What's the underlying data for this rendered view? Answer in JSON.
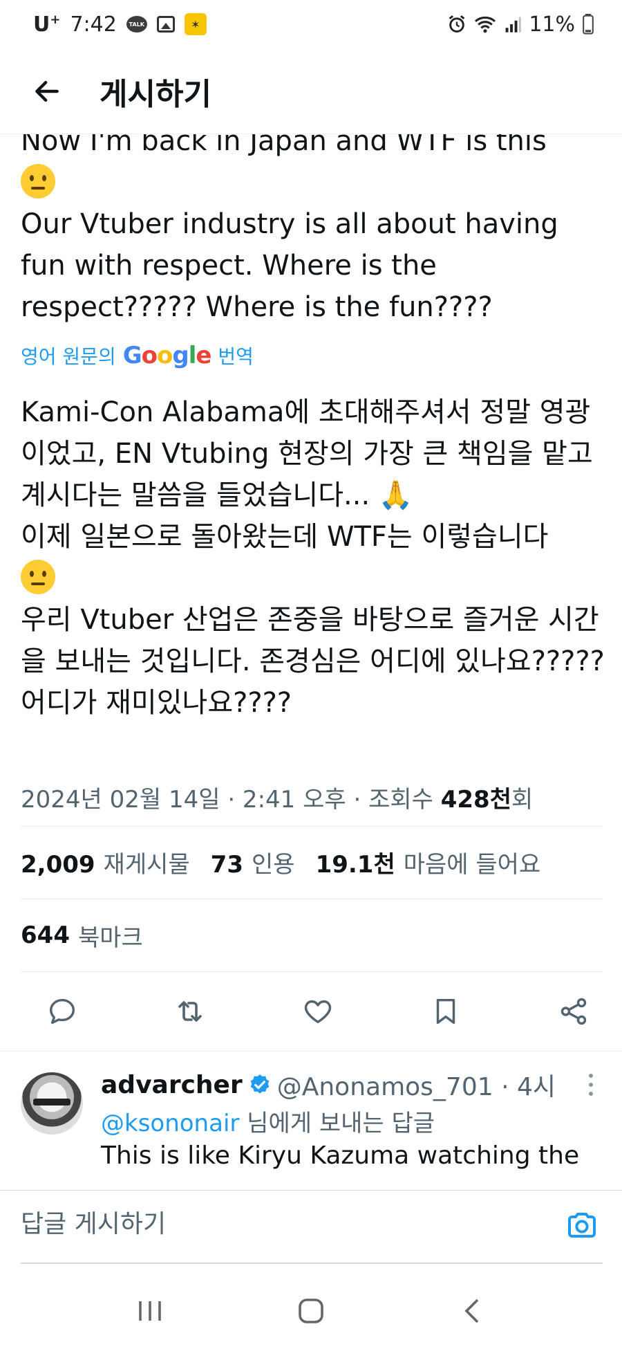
{
  "status_bar": {
    "carrier": "U",
    "carrier_sup": "+",
    "time": "7:42",
    "talk_label": "TALK",
    "battery": "11%",
    "icons": [
      "kakaotalk-icon",
      "gallery-icon",
      "kakao-app-icon",
      "alarm-icon",
      "wifi-icon",
      "signal-icon",
      "battery-icon"
    ]
  },
  "header": {
    "title": "게시하기",
    "back_icon": "arrow-left-icon"
  },
  "tweet": {
    "text_line1": "Now I'm back in Japan and WTF is this",
    "text_line2": "Our Vtuber industry is all about having fun with respect. Where is the respect????? Where is the fun????",
    "translate_prefix": "영어 원문의",
    "translate_brand": "Google",
    "translate_suffix": "번역",
    "translated_line1": "Kami-Con Alabama에 초대해주셔서 정말 영광이었고, EN Vtubing 현장의 가장 큰 책임을 맡고 계시다는 말씀을 들었습니다...",
    "translated_line2": "이제 일본으로 돌아왔는데 WTF는 이렇습니다",
    "translated_line3": "우리 Vtuber 산업은 존중을 바탕으로 즐거운 시간을 보내는 것입니다. 존경심은 어디에 있나요????? 어디가 재미있나요????",
    "meta_date": "2024년 02월 14일 · 2:41 오후 · 조회수 ",
    "meta_views": "428천",
    "meta_views_suffix": "회"
  },
  "stats": {
    "reposts_count": "2,009",
    "reposts_label": "재게시물",
    "quotes_count": "73",
    "quotes_label": "인용",
    "likes_count": "19.1천",
    "likes_label": "마음에 들어요",
    "bookmarks_count": "644",
    "bookmarks_label": "북마크"
  },
  "actions": [
    "reply-icon",
    "retweet-icon",
    "like-icon",
    "bookmark-icon",
    "share-icon"
  ],
  "reply": {
    "name": "advarcher",
    "handle": "@Anonamos_701 · 4시",
    "mention": "@ksononair",
    "reply_to_suffix": " 님에게 보내는 답글",
    "text": "This is like Kiryu Kazuma watching the"
  },
  "compose": {
    "placeholder": "답글 게시하기"
  },
  "colors": {
    "accent": "#1d9bf0",
    "text": "#0f1419",
    "secondary": "#536471"
  }
}
